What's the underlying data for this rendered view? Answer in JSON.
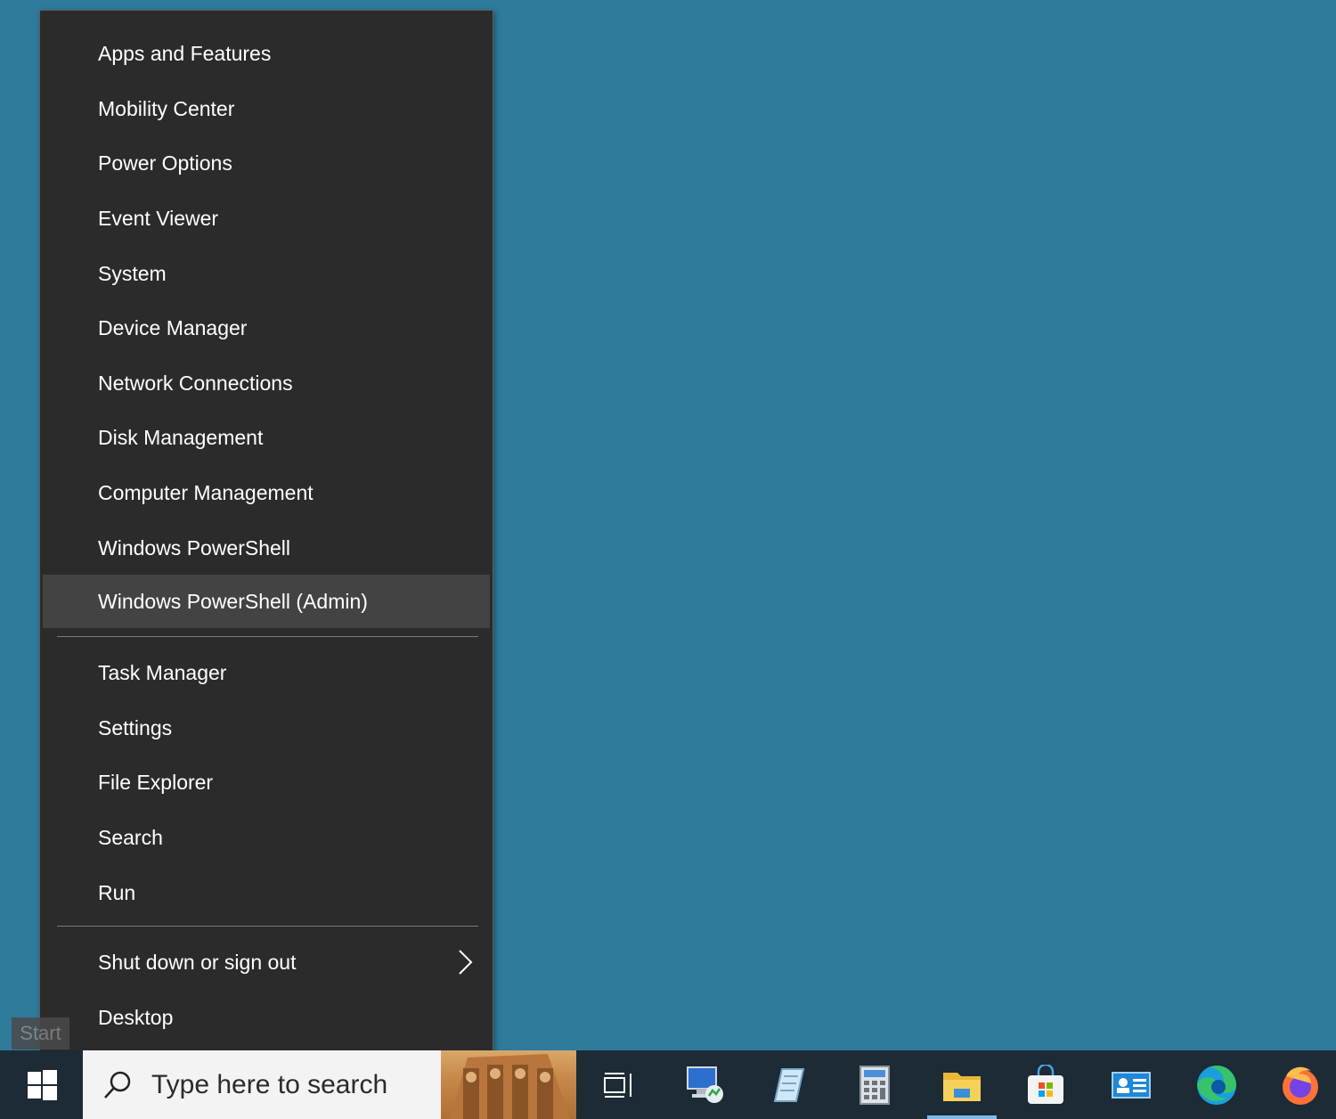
{
  "menu": {
    "items": [
      {
        "label": "Apps and Features"
      },
      {
        "label": "Mobility Center"
      },
      {
        "label": "Power Options"
      },
      {
        "label": "Event Viewer"
      },
      {
        "label": "System"
      },
      {
        "label": "Device Manager"
      },
      {
        "label": "Network Connections"
      },
      {
        "label": "Disk Management"
      },
      {
        "label": "Computer Management"
      },
      {
        "label": "Windows PowerShell"
      },
      {
        "label": "Windows PowerShell (Admin)"
      },
      {
        "label": "Task Manager"
      },
      {
        "label": "Settings"
      },
      {
        "label": "File Explorer"
      },
      {
        "label": "Search"
      },
      {
        "label": "Run"
      },
      {
        "label": "Shut down or sign out"
      },
      {
        "label": "Desktop"
      }
    ],
    "highlighted_item": "Windows PowerShell (Admin)"
  },
  "tooltip": {
    "text": "Start"
  },
  "taskbar": {
    "search": {
      "placeholder": "Type here to search"
    },
    "icons": [
      {
        "name": "task-view-icon"
      },
      {
        "name": "remote-desktop-icon"
      },
      {
        "name": "notepad-icon"
      },
      {
        "name": "calculator-icon"
      },
      {
        "name": "file-explorer-icon",
        "active": true
      },
      {
        "name": "microsoft-store-icon"
      },
      {
        "name": "contact-card-icon"
      },
      {
        "name": "edge-icon"
      },
      {
        "name": "firefox-icon"
      }
    ]
  },
  "colors": {
    "desktop": "#2e7b9c",
    "menu_bg": "#2b2b2b",
    "menu_hover": "#434343",
    "taskbar": "#1c2b36",
    "accent": "#7fb9e8"
  }
}
